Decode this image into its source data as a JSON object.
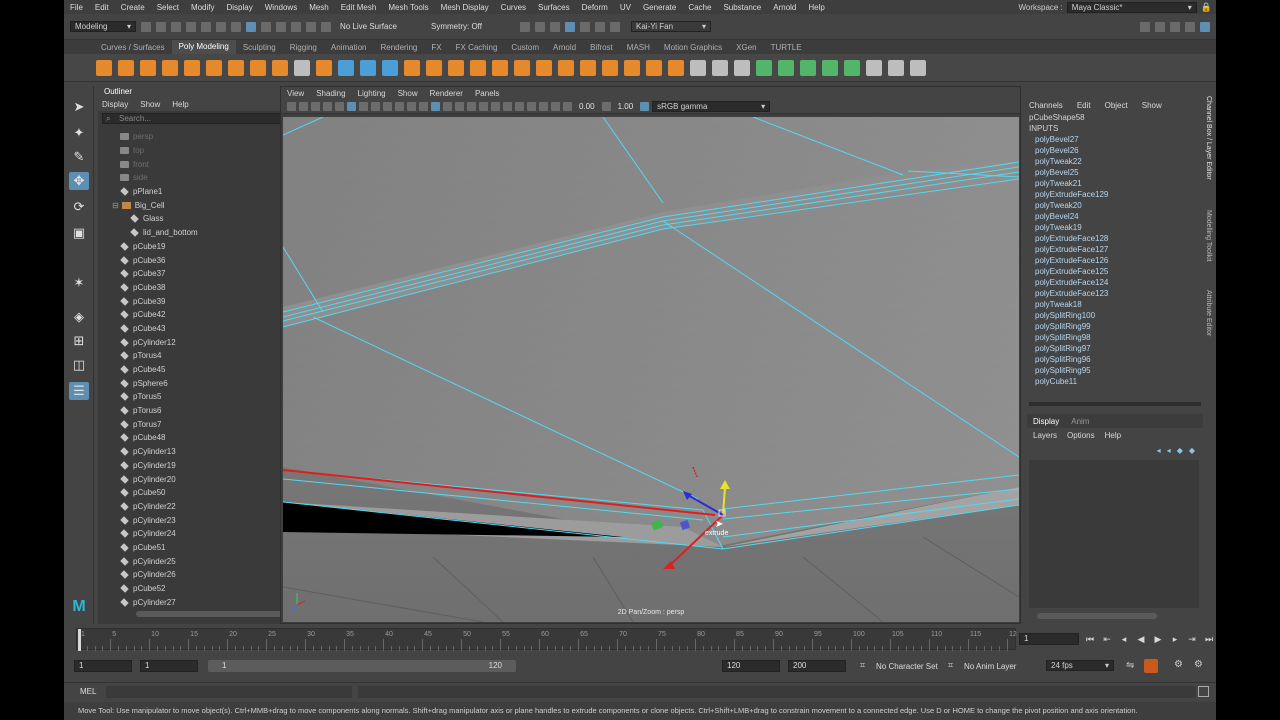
{
  "menubar": {
    "items": [
      "File",
      "Edit",
      "Create",
      "Select",
      "Modify",
      "Display",
      "Windows",
      "Mesh",
      "Edit Mesh",
      "Mesh Tools",
      "Mesh Display",
      "Curves",
      "Surfaces",
      "Deform",
      "UV",
      "Generate",
      "Cache",
      "Substance",
      "Arnold",
      "Help"
    ],
    "workspace_label": "Workspace :",
    "workspace_value": "Maya Classic*"
  },
  "statusline": {
    "mode": "Modeling",
    "live_surface": "No Live Surface",
    "symmetry": "Symmetry: Off",
    "user": "Kai-Yi Fan"
  },
  "shelf_tabs": [
    "Curves / Surfaces",
    "Poly Modeling",
    "Sculpting",
    "Rigging",
    "Animation",
    "Rendering",
    "FX",
    "FX Caching",
    "Custom",
    "Arnold",
    "Bifrost",
    "MASH",
    "Motion Graphics",
    "XGen",
    "TURTLE"
  ],
  "shelf_active_tab": "Poly Modeling",
  "outliner": {
    "title": "Outliner",
    "menu": [
      "Display",
      "Show",
      "Help"
    ],
    "search_placeholder": "Search...",
    "items": [
      {
        "label": "persp",
        "dim": true,
        "indent": 0,
        "type": "cam"
      },
      {
        "label": "top",
        "dim": true,
        "indent": 0,
        "type": "cam"
      },
      {
        "label": "front",
        "dim": true,
        "indent": 0,
        "type": "cam"
      },
      {
        "label": "side",
        "dim": true,
        "indent": 0,
        "type": "cam"
      },
      {
        "label": "pPlane1",
        "dim": false,
        "indent": 0,
        "type": "mesh"
      },
      {
        "label": "Big_Cell",
        "dim": false,
        "indent": 0,
        "type": "grp"
      },
      {
        "label": "Glass",
        "dim": false,
        "indent": 1,
        "type": "mesh"
      },
      {
        "label": "lid_and_bottom",
        "dim": false,
        "indent": 1,
        "type": "mesh"
      },
      {
        "label": "pCube19",
        "dim": false,
        "indent": 0,
        "type": "mesh"
      },
      {
        "label": "pCube36",
        "dim": false,
        "indent": 0,
        "type": "mesh"
      },
      {
        "label": "pCube37",
        "dim": false,
        "indent": 0,
        "type": "mesh"
      },
      {
        "label": "pCube38",
        "dim": false,
        "indent": 0,
        "type": "mesh"
      },
      {
        "label": "pCube39",
        "dim": false,
        "indent": 0,
        "type": "mesh"
      },
      {
        "label": "pCube42",
        "dim": false,
        "indent": 0,
        "type": "mesh"
      },
      {
        "label": "pCube43",
        "dim": false,
        "indent": 0,
        "type": "mesh"
      },
      {
        "label": "pCylinder12",
        "dim": false,
        "indent": 0,
        "type": "mesh"
      },
      {
        "label": "pTorus4",
        "dim": false,
        "indent": 0,
        "type": "mesh"
      },
      {
        "label": "pCube45",
        "dim": false,
        "indent": 0,
        "type": "mesh"
      },
      {
        "label": "pSphere6",
        "dim": false,
        "indent": 0,
        "type": "mesh"
      },
      {
        "label": "pTorus5",
        "dim": false,
        "indent": 0,
        "type": "mesh"
      },
      {
        "label": "pTorus6",
        "dim": false,
        "indent": 0,
        "type": "mesh"
      },
      {
        "label": "pTorus7",
        "dim": false,
        "indent": 0,
        "type": "mesh"
      },
      {
        "label": "pCube48",
        "dim": false,
        "indent": 0,
        "type": "mesh"
      },
      {
        "label": "pCylinder13",
        "dim": false,
        "indent": 0,
        "type": "mesh"
      },
      {
        "label": "pCylinder19",
        "dim": false,
        "indent": 0,
        "type": "mesh"
      },
      {
        "label": "pCylinder20",
        "dim": false,
        "indent": 0,
        "type": "mesh"
      },
      {
        "label": "pCube50",
        "dim": false,
        "indent": 0,
        "type": "mesh"
      },
      {
        "label": "pCylinder22",
        "dim": false,
        "indent": 0,
        "type": "mesh"
      },
      {
        "label": "pCylinder23",
        "dim": false,
        "indent": 0,
        "type": "mesh"
      },
      {
        "label": "pCylinder24",
        "dim": false,
        "indent": 0,
        "type": "mesh"
      },
      {
        "label": "pCube51",
        "dim": false,
        "indent": 0,
        "type": "mesh"
      },
      {
        "label": "pCylinder25",
        "dim": false,
        "indent": 0,
        "type": "mesh"
      },
      {
        "label": "pCylinder26",
        "dim": false,
        "indent": 0,
        "type": "mesh"
      },
      {
        "label": "pCube52",
        "dim": false,
        "indent": 0,
        "type": "mesh"
      },
      {
        "label": "pCylinder27",
        "dim": false,
        "indent": 0,
        "type": "mesh"
      }
    ]
  },
  "viewport": {
    "menu": [
      "View",
      "Shading",
      "Lighting",
      "Show",
      "Renderer",
      "Panels"
    ],
    "value_a": "0.00",
    "value_b": "1.00",
    "color_space": "sRGB gamma",
    "camera_label": "2D Pan/Zoom : persp",
    "manip_label": "extrude"
  },
  "channelbox": {
    "menu": [
      "Channels",
      "Edit",
      "Object",
      "Show"
    ],
    "object": "pCubeShape58",
    "inputs_label": "INPUTS",
    "inputs": [
      "polyBevel27",
      "polyBevel26",
      "polyTweak22",
      "polyBevel25",
      "polyTweak21",
      "polyExtrudeFace129",
      "polyTweak20",
      "polyBevel24",
      "polyTweak19",
      "polyExtrudeFace128",
      "polyExtrudeFace127",
      "polyExtrudeFace126",
      "polyExtrudeFace125",
      "polyExtrudeFace124",
      "polyExtrudeFace123",
      "polyTweak18",
      "polySplitRing100",
      "polySplitRing99",
      "polySplitRing98",
      "polySplitRing97",
      "polySplitRing96",
      "polySplitRing95",
      "polyCube11"
    ]
  },
  "layer_editor": {
    "tabs": [
      "Display",
      "Anim"
    ],
    "menu": [
      "Layers",
      "Options",
      "Help"
    ]
  },
  "side_tabs": [
    "Channel Box / Layer Editor",
    "Modelling Toolkit",
    "Attribute Editor"
  ],
  "timeline": {
    "ticks": [
      "1",
      "5",
      "10",
      "15",
      "20",
      "25",
      "30",
      "35",
      "40",
      "45",
      "50",
      "55",
      "60",
      "65",
      "70",
      "75",
      "80",
      "85",
      "90",
      "95",
      "100",
      "105",
      "110",
      "115",
      "12"
    ],
    "current_frame": "1"
  },
  "range": {
    "start": "1",
    "inner_start": "1",
    "slider_start": "1",
    "slider_end": "120",
    "end": "120",
    "anim_end": "200",
    "character_set": "No Character Set",
    "anim_layer": "No Anim Layer",
    "fps": "24 fps"
  },
  "cmdline": {
    "label": "MEL"
  },
  "helpline": {
    "text": "Move Tool: Use manipulator to move object(s). Ctrl+MMB+drag to move components along normals. Shift+drag manipulator axis or plane handles to extrude components or clone objects. Ctrl+Shift+LMB+drag to constrain movement to a connected edge. Use D or HOME to change the pivot position and axis orientation."
  }
}
